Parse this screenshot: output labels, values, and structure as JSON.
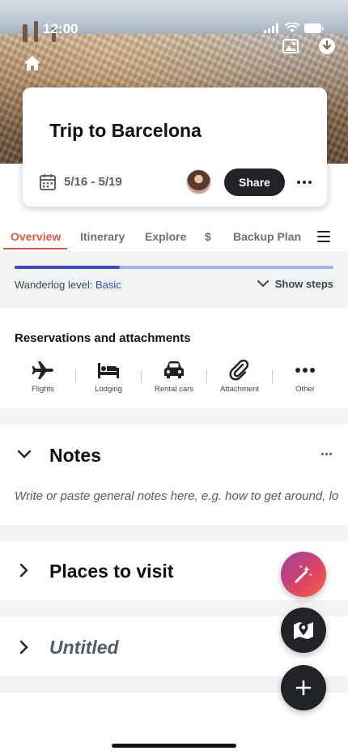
{
  "status_bar": {
    "time": "12:00"
  },
  "trip": {
    "title": "Trip to Barcelona",
    "dates": "5/16 - 5/19",
    "share_label": "Share"
  },
  "tabs": [
    {
      "label": "Overview",
      "active": true
    },
    {
      "label": "Itinerary"
    },
    {
      "label": "Explore"
    },
    {
      "label": "$"
    },
    {
      "label": "Backup Plan"
    }
  ],
  "progress": {
    "fraction": 0.33,
    "level_prefix": "Wanderlog level: ",
    "level_value": "Basic",
    "steps_label": "Show steps"
  },
  "reservations": {
    "title": "Reservations and attachments",
    "items": [
      {
        "label": "Flights",
        "icon": "airplane-icon"
      },
      {
        "label": "Lodging",
        "icon": "bed-icon"
      },
      {
        "label": "Rental cars",
        "icon": "car-icon"
      },
      {
        "label": "Attachment",
        "icon": "paperclip-icon"
      },
      {
        "label": "Other",
        "icon": "more-icon"
      }
    ]
  },
  "notes": {
    "title": "Notes",
    "placeholder": "Write or paste general notes here, e.g. how to get around, lo"
  },
  "places": {
    "title": "Places to visit"
  },
  "untitled": {
    "title": "Untitled"
  },
  "colors": {
    "accent": "#e5573f",
    "progress": "#3a4cc8",
    "dark_button": "#212427"
  }
}
